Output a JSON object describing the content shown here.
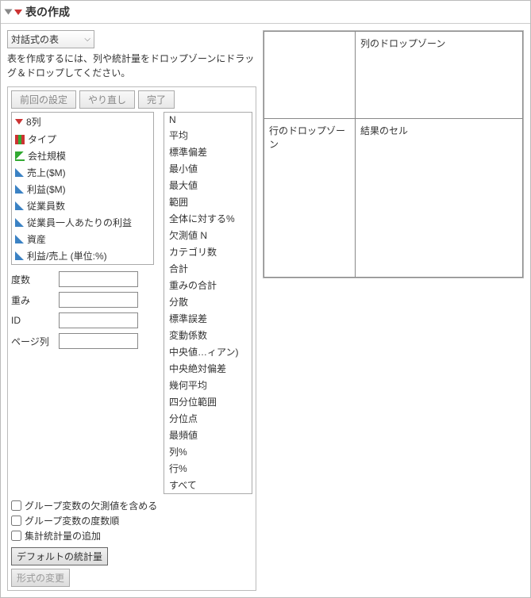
{
  "title": "表の作成",
  "dropdown_value": "対話式の表",
  "instruction": "表を作成するには、列や統計量をドロップゾーンにドラッグ＆ドロップしてください。",
  "buttons": {
    "prev": "前回の設定",
    "redo": "やり直し",
    "done": "完了"
  },
  "columns_header": "8列",
  "columns": [
    {
      "label": "タイプ",
      "icon": "bars"
    },
    {
      "label": "会社規模",
      "icon": "step"
    },
    {
      "label": "売上($M)",
      "icon": "tri"
    },
    {
      "label": "利益($M)",
      "icon": "tri"
    },
    {
      "label": "従業員数",
      "icon": "tri"
    },
    {
      "label": "従業員一人あたりの利益",
      "icon": "tri"
    },
    {
      "label": "資産",
      "icon": "tri"
    },
    {
      "label": "利益/売上 (単位:%)",
      "icon": "tri"
    }
  ],
  "stats": [
    "N",
    "平均",
    "標準偏差",
    "最小値",
    "最大値",
    "範囲",
    "全体に対する%",
    "欠測値 N",
    "カテゴリ数",
    "合計",
    "重みの合計",
    "分散",
    "標準誤差",
    "変動係数",
    "中央値…ィアン)",
    "中央絶対偏差",
    "幾何平均",
    "四分位範囲",
    "分位点",
    "最頻値",
    "列%",
    "行%",
    "すべて"
  ],
  "fields": {
    "freq": "度数",
    "weight": "重み",
    "id": "ID",
    "page": "ページ列"
  },
  "checks": {
    "c1": "グループ変数の欠測値を含める",
    "c2": "グループ変数の度数順",
    "c3": "集計統計量の追加"
  },
  "default_stats_btn": "デフォルトの統計量",
  "change_format_btn": "形式の変更",
  "dropzone": {
    "col": "列のドロップゾーン",
    "row": "行のドロップゾーン",
    "cell": "結果のセル"
  }
}
